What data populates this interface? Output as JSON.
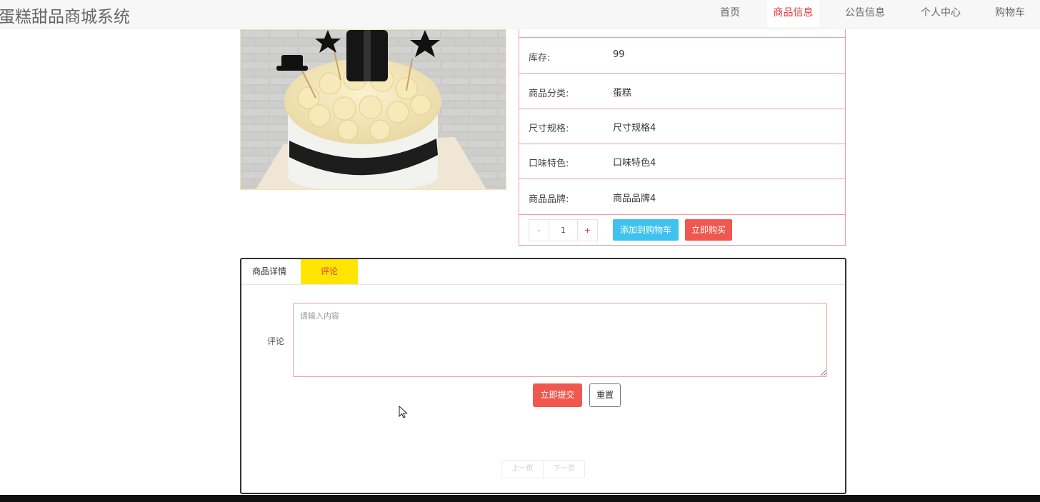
{
  "header": {
    "site_title": "蛋糕甜品商城系统",
    "nav": [
      {
        "label": "首页",
        "active": false
      },
      {
        "label": "商品信息",
        "active": true
      },
      {
        "label": "公告信息",
        "active": false
      },
      {
        "label": "个人中心",
        "active": false
      },
      {
        "label": "购物车",
        "active": false
      }
    ]
  },
  "product": {
    "image_icon": "cake-photo",
    "details": [
      {
        "label": "库存:",
        "value": "99"
      },
      {
        "label": "商品分类:",
        "value": "蛋糕"
      },
      {
        "label": "尺寸规格:",
        "value": "尺寸规格4"
      },
      {
        "label": "口味特色:",
        "value": "口味特色4"
      },
      {
        "label": "商品品牌:",
        "value": "商品品牌4"
      }
    ],
    "quantity": {
      "minus": "-",
      "value": "1",
      "plus": "+"
    },
    "add_to_cart_label": "添加到购物车",
    "buy_now_label": "立即购买"
  },
  "tabs": {
    "detail_label": "商品详情",
    "comment_label": "评论",
    "active": "评论"
  },
  "comment_form": {
    "label": "评论",
    "placeholder": "请输入内容",
    "value": "",
    "submit_label": "立即提交",
    "reset_label": "重置"
  },
  "pagination": {
    "prev_label": "上一页",
    "next_label": "下一页"
  },
  "colors": {
    "accent_red": "#f0574e",
    "active_nav": "#e4393c",
    "cart_blue": "#3fc3ee",
    "tab_yellow": "#ffe500"
  }
}
